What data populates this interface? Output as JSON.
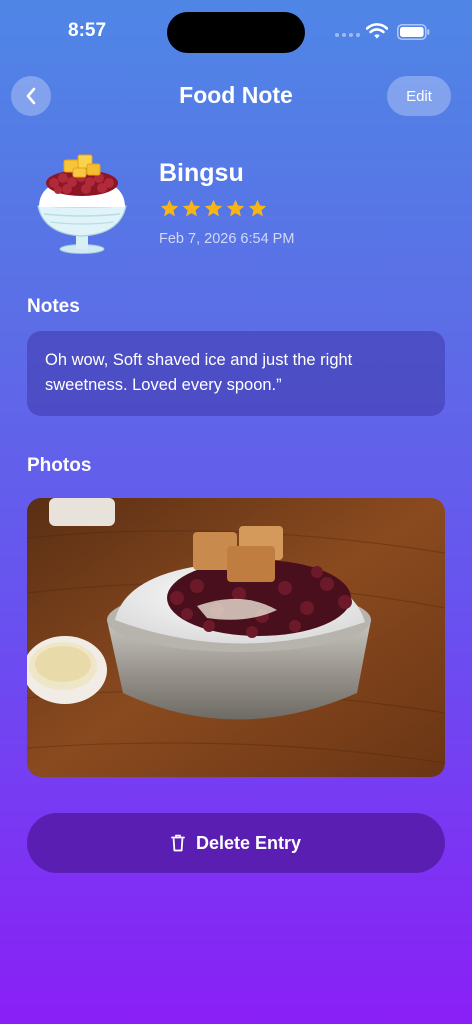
{
  "status_bar": {
    "time": "8:57"
  },
  "nav": {
    "title": "Food Note",
    "edit_label": "Edit"
  },
  "entry": {
    "name": "Bingsu",
    "rating": 5,
    "rating_max": 5,
    "timestamp": "Feb 7, 2026 6:54 PM",
    "icon": "shaved-ice-emoji"
  },
  "notes": {
    "title": "Notes",
    "text": "Oh wow, Soft shaved ice and just the right sweetness. Loved every spoon.”"
  },
  "photos": {
    "title": "Photos"
  },
  "actions": {
    "delete_label": "Delete Entry"
  },
  "colors": {
    "background_top": "#4f86e6",
    "background_bottom": "#8a1ff6",
    "star": "#f6b417",
    "delete_button": "#5a1fb2"
  }
}
